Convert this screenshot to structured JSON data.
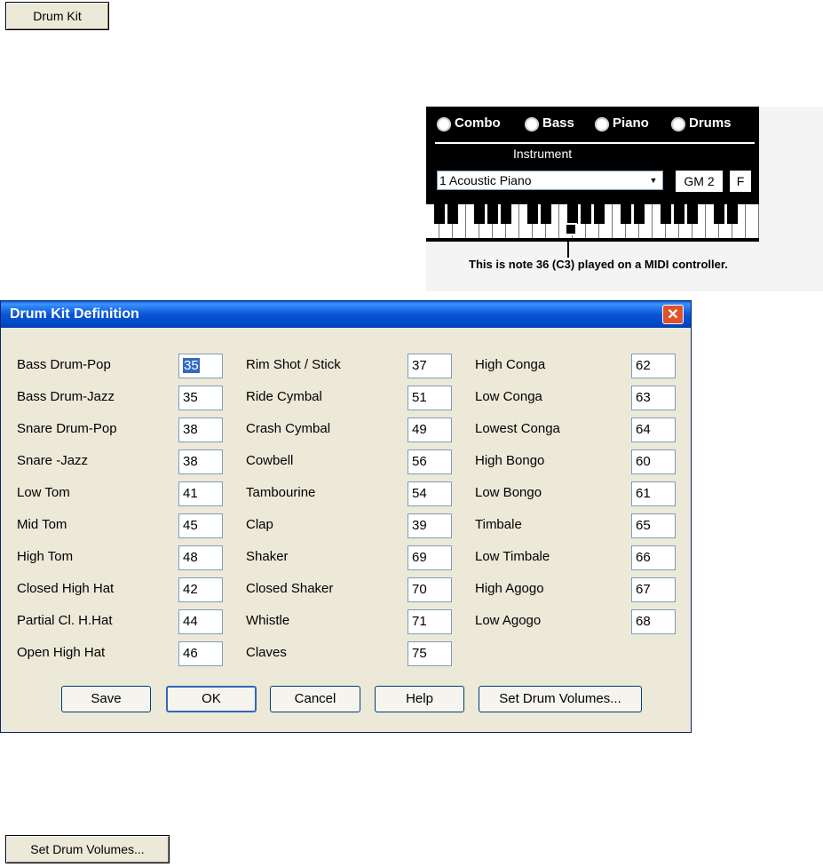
{
  "top_button": {
    "label": "Drum Kit"
  },
  "bottom_button": {
    "label": "Set Drum Volumes..."
  },
  "midi_panel": {
    "radios": [
      "Combo",
      "Bass",
      "Piano",
      "Drums"
    ],
    "instrument_label": "Instrument",
    "instrument_value": "1 Acoustic Piano",
    "gm_button": "GM 2",
    "f_button": "F",
    "caption": "This is note 36 (C3) played on a MIDI controller."
  },
  "dialog": {
    "title": "Drum Kit Definition",
    "close_symbol": "✕",
    "columns": [
      [
        {
          "label": "Bass Drum-Pop",
          "value": "35"
        },
        {
          "label": "Bass Drum-Jazz",
          "value": "35"
        },
        {
          "label": "Snare Drum-Pop",
          "value": "38"
        },
        {
          "label": "Snare -Jazz",
          "value": "38"
        },
        {
          "label": "Low Tom",
          "value": "41"
        },
        {
          "label": "Mid Tom",
          "value": "45"
        },
        {
          "label": "High Tom",
          "value": "48"
        },
        {
          "label": "Closed High Hat",
          "value": "42"
        },
        {
          "label": "Partial Cl. H.Hat",
          "value": "44"
        },
        {
          "label": "Open High Hat",
          "value": "46"
        }
      ],
      [
        {
          "label": "Rim Shot / Stick",
          "value": "37"
        },
        {
          "label": "Ride Cymbal",
          "value": "51"
        },
        {
          "label": "Crash Cymbal",
          "value": "49"
        },
        {
          "label": "Cowbell",
          "value": "56"
        },
        {
          "label": "Tambourine",
          "value": "54"
        },
        {
          "label": "Clap",
          "value": "39"
        },
        {
          "label": "Shaker",
          "value": "69"
        },
        {
          "label": "Closed Shaker",
          "value": "70"
        },
        {
          "label": "Whistle",
          "value": "71"
        },
        {
          "label": "Claves",
          "value": "75"
        }
      ],
      [
        {
          "label": "High Conga",
          "value": "62"
        },
        {
          "label": "Low Conga",
          "value": "63"
        },
        {
          "label": "Lowest Conga",
          "value": "64"
        },
        {
          "label": "High Bongo",
          "value": "60"
        },
        {
          "label": "Low Bongo",
          "value": "61"
        },
        {
          "label": "Timbale",
          "value": "65"
        },
        {
          "label": "Low Timbale",
          "value": "66"
        },
        {
          "label": "High Agogo",
          "value": "67"
        },
        {
          "label": "Low Agogo",
          "value": "68"
        }
      ]
    ],
    "buttons": {
      "save": "Save",
      "ok": "OK",
      "cancel": "Cancel",
      "help": "Help",
      "set_volumes": "Set Drum Volumes..."
    }
  },
  "colors": {
    "titlebar": "#0a55d6",
    "dialog_bg": "#ece9d8",
    "close_button": "#e0512b"
  }
}
